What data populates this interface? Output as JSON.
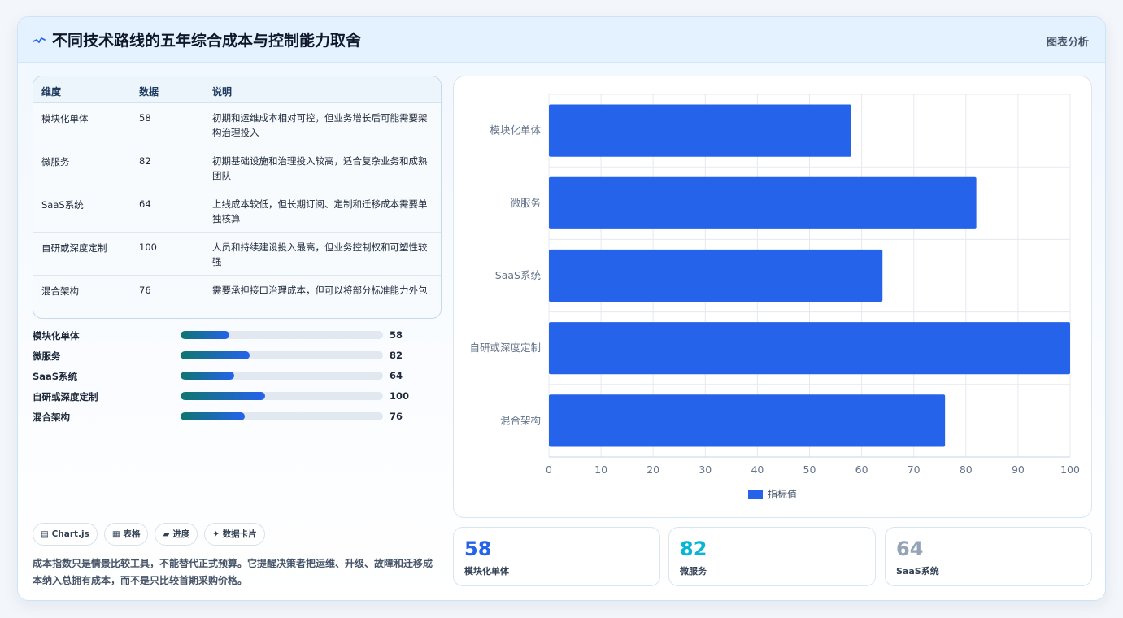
{
  "header": {
    "title": "不同技术路线的五年综合成本与控制能力取舍",
    "tag": "图表分析"
  },
  "table": {
    "columns": [
      "维度",
      "数据",
      "说明"
    ],
    "rows": [
      {
        "name": "模块化单体",
        "value": "58",
        "desc": "初期和运维成本相对可控，但业务增长后可能需要架构治理投入"
      },
      {
        "name": "微服务",
        "value": "82",
        "desc": "初期基础设施和治理投入较高，适合复杂业务和成熟团队"
      },
      {
        "name": "SaaS系统",
        "value": "64",
        "desc": "上线成本较低，但长期订阅、定制和迁移成本需要单独核算"
      },
      {
        "name": "自研或深度定制",
        "value": "100",
        "desc": "人员和持续建设投入最高，但业务控制权和可塑性较强"
      },
      {
        "name": "混合架构",
        "value": "76",
        "desc": "需要承担接口治理成本，但可以将部分标准能力外包"
      }
    ]
  },
  "progress": {
    "max": 240,
    "items": [
      {
        "label": "模块化单体",
        "value": 58
      },
      {
        "label": "微服务",
        "value": 82
      },
      {
        "label": "SaaS系统",
        "value": 64
      },
      {
        "label": "自研或深度定制",
        "value": 100
      },
      {
        "label": "混合架构",
        "value": 76
      }
    ]
  },
  "chips": [
    "▤ Chart.js",
    "▦ 表格",
    "▰ 进度",
    "✦ 数据卡片"
  ],
  "note": "成本指数只是情景比较工具，不能替代正式预算。它提醒决策者把运维、升级、故障和迁移成本纳入总拥有成本，而不是只比较首期采购价格。",
  "chart_data": {
    "type": "bar",
    "orientation": "horizontal",
    "categories": [
      "模块化单体",
      "微服务",
      "SaaS系统",
      "自研或深度定制",
      "混合架构"
    ],
    "series": [
      {
        "name": "指标值",
        "values": [
          58,
          82,
          64,
          100,
          76
        ],
        "color": "#2563eb"
      }
    ],
    "xlim": [
      0,
      100
    ],
    "xticks": [
      0,
      10,
      20,
      30,
      40,
      50,
      60,
      70,
      80,
      90,
      100
    ],
    "grid": true,
    "legend": "bottom"
  },
  "stats": [
    {
      "value": "58",
      "label": "模块化单体",
      "color": "#2563eb"
    },
    {
      "value": "82",
      "label": "微服务",
      "color": "#06b6d4"
    },
    {
      "value": "64",
      "label": "SaaS系统",
      "color": "#94a3b8"
    }
  ],
  "colors": {
    "accent": "#2563eb",
    "progress_start": "#0f766e",
    "progress_end": "#2563eb"
  }
}
